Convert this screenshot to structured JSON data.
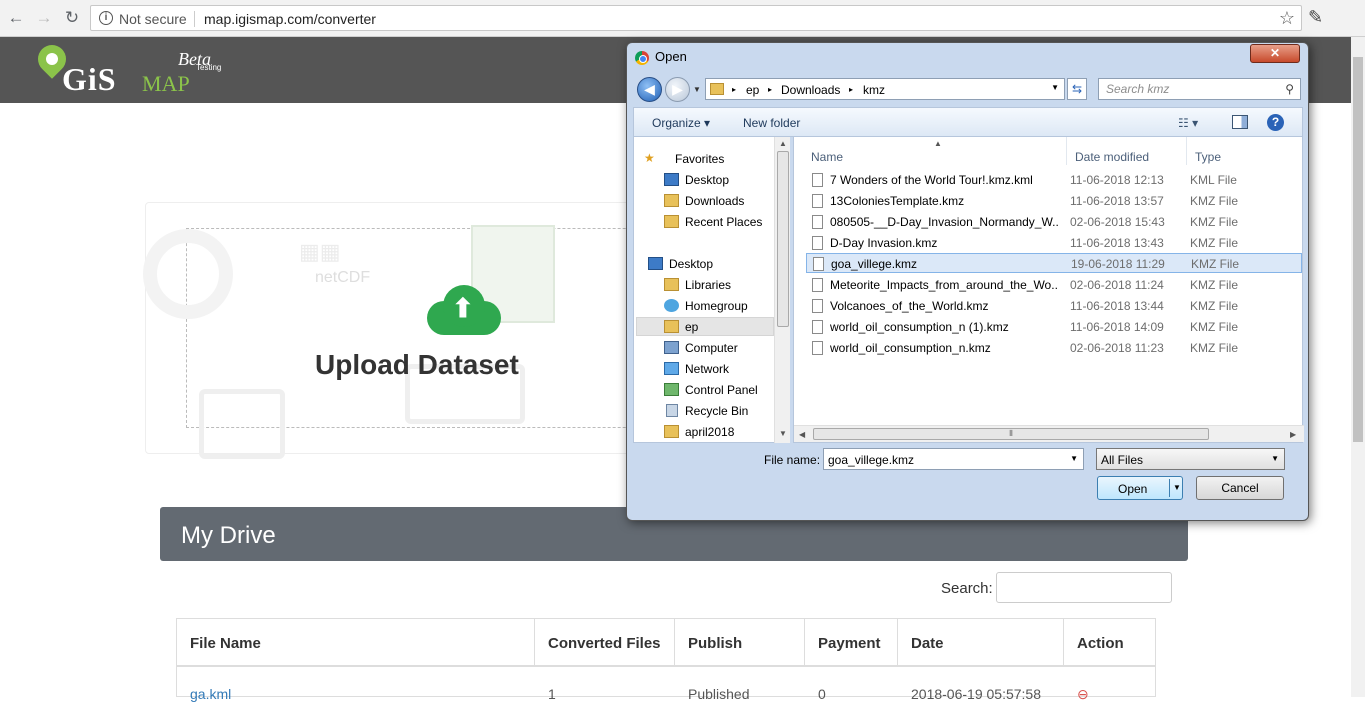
{
  "browser": {
    "security_text": "Not secure",
    "url": "map.igismap.com/converter"
  },
  "site": {
    "logo": {
      "name": "GiS",
      "map": "MAP",
      "beta": "Beta",
      "testing": "Testing"
    },
    "upload_title": "Upload Dataset",
    "upload_bg_labels": [
      "netCDF"
    ],
    "drive_title": "My Drive",
    "search_label": "Search:",
    "table": {
      "headers": [
        "File Name",
        "Converted Files",
        "Publish",
        "Payment",
        "Date",
        "Action"
      ],
      "rows": [
        [
          "ga.kml",
          "1",
          "Published",
          "0",
          "2018-06-19 05:57:58",
          ""
        ]
      ]
    }
  },
  "dialog": {
    "title": "Open",
    "close_label": "✕",
    "address": [
      "ep",
      "Downloads",
      "kmz"
    ],
    "search_placeholder": "Search kmz",
    "toolbar": {
      "organize": "Organize ▾",
      "new_folder": "New folder"
    },
    "nav": {
      "favorites": "Favorites",
      "items": [
        {
          "label": "Desktop"
        },
        {
          "label": "Downloads"
        },
        {
          "label": "Recent Places"
        },
        {
          "label": "Desktop"
        },
        {
          "label": "Libraries"
        },
        {
          "label": "Homegroup"
        },
        {
          "label": "ep"
        },
        {
          "label": "Computer"
        },
        {
          "label": "Network"
        },
        {
          "label": "Control Panel"
        },
        {
          "label": "Recycle Bin"
        },
        {
          "label": "april2018"
        }
      ]
    },
    "columns": [
      "Name",
      "Date modified",
      "Type"
    ],
    "files": [
      {
        "name": "7 Wonders of the World Tour!.kmz.kml",
        "date": "11-06-2018 12:13",
        "type": "KML File"
      },
      {
        "name": "13ColoniesTemplate.kmz",
        "date": "11-06-2018 13:57",
        "type": "KMZ File"
      },
      {
        "name": "080505-__D-Day_Invasion_Normandy_W...",
        "date": "02-06-2018 15:43",
        "type": "KMZ File"
      },
      {
        "name": "D-Day Invasion.kmz",
        "date": "11-06-2018 13:43",
        "type": "KMZ File"
      },
      {
        "name": "goa_villege.kmz",
        "date": "19-06-2018 11:29",
        "type": "KMZ File"
      },
      {
        "name": "Meteorite_Impacts_from_around_the_Wo...",
        "date": "02-06-2018 11:24",
        "type": "KMZ File"
      },
      {
        "name": "Volcanoes_of_the_World.kmz",
        "date": "11-06-2018 13:44",
        "type": "KMZ File"
      },
      {
        "name": "world_oil_consumption_n (1).kmz",
        "date": "11-06-2018 14:09",
        "type": "KMZ File"
      },
      {
        "name": "world_oil_consumption_n.kmz",
        "date": "02-06-2018 11:23",
        "type": "KMZ File"
      }
    ],
    "filename_label": "File name:",
    "filename_value": "goa_villege.kmz",
    "filter_value": "All Files",
    "open_label": "Open",
    "cancel_label": "Cancel",
    "colors": {
      "selected_row": "#dbe8f8",
      "accent": "#2fa84f"
    }
  }
}
